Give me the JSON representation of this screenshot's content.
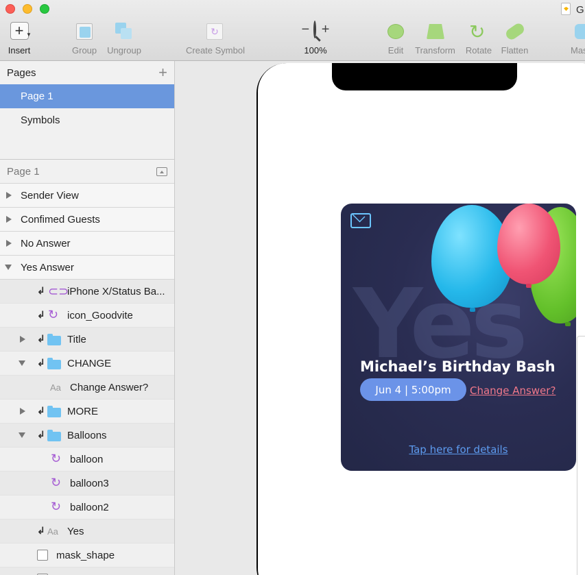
{
  "window": {
    "title": "G"
  },
  "toolbar": {
    "insert": "Insert",
    "group": "Group",
    "ungroup": "Ungroup",
    "create_symbol": "Create Symbol",
    "zoom_minus": "−",
    "zoom_plus": "+",
    "zoom_level": "100%",
    "edit": "Edit",
    "transform": "Transform",
    "rotate": "Rotate",
    "flatten": "Flatten",
    "mask": "Mas"
  },
  "pages": {
    "header": "Pages",
    "add": "+",
    "items": [
      "Page 1",
      "Symbols"
    ]
  },
  "layers": {
    "header": "Page 1",
    "items": [
      "Sender View",
      "Confimed Guests",
      "No Answer",
      "Yes Answer",
      "iPhone X/Status Ba...",
      "icon_Goodvite",
      "Title",
      "CHANGE",
      "Change Answer?",
      "MORE",
      "Balloons",
      "balloon",
      "balloon3",
      "balloon2",
      "Yes",
      "mask_shape"
    ],
    "text_icon": "Aa"
  },
  "card": {
    "bg_word": "Yes",
    "title": "Michael’s Birthday Bash",
    "date": "Jun 4 | 5:00pm",
    "change_link": "Change Answer?",
    "details_link": "Tap here for details"
  },
  "colors": {
    "selection": "#6a97dd",
    "card_bg": "#2a2d52",
    "pill": "#6b93e8",
    "change_link": "#f0788a",
    "details_link": "#5d9bef"
  }
}
